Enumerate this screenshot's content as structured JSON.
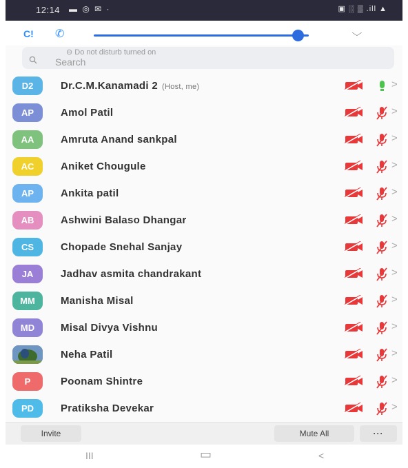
{
  "status_bar": {
    "time": "12:14",
    "left_icons": "▬ ◎ ✉ ·",
    "right_icons": "▣ ░ ▒ .ill ▲"
  },
  "notification": {
    "app_label": "C!",
    "dnd_text": "Do not disturb turned on"
  },
  "search": {
    "placeholder": "Search"
  },
  "participants": [
    {
      "initials": "D2",
      "name": "Dr.C.M.Kanamadi 2",
      "tag": "(Host, me)",
      "color": "#5ab4e6",
      "muted": false
    },
    {
      "initials": "AP",
      "name": "Amol Patil",
      "tag": "",
      "color": "#7b8ed6",
      "muted": true
    },
    {
      "initials": "AA",
      "name": "Amruta Anand sankpal",
      "tag": "",
      "color": "#7ec27e",
      "muted": true
    },
    {
      "initials": "AC",
      "name": "Aniket Chougule",
      "tag": "",
      "color": "#f0d02a",
      "muted": true
    },
    {
      "initials": "AP",
      "name": "Ankita patil",
      "tag": "",
      "color": "#6db3ef",
      "muted": true
    },
    {
      "initials": "AB",
      "name": "Ashwini Balaso Dhangar",
      "tag": "",
      "color": "#e48fbf",
      "muted": true
    },
    {
      "initials": "CS",
      "name": "Chopade Snehal Sanjay",
      "tag": "",
      "color": "#4fb6e3",
      "muted": true
    },
    {
      "initials": "JA",
      "name": "Jadhav asmita chandrakant",
      "tag": "",
      "color": "#9b7fd6",
      "muted": true
    },
    {
      "initials": "MM",
      "name": "Manisha Misal",
      "tag": "",
      "color": "#4db59e",
      "muted": true
    },
    {
      "initials": "MD",
      "name": "Misal Divya Vishnu",
      "tag": "",
      "color": "#8f84d6",
      "muted": true
    },
    {
      "initials": "",
      "name": "Neha Patil",
      "tag": "",
      "color": "#4a6f9c",
      "muted": true,
      "photo": true
    },
    {
      "initials": "P",
      "name": "Poonam  Shintre",
      "tag": "",
      "color": "#ef6a6a",
      "muted": true
    },
    {
      "initials": "PD",
      "name": "Pratiksha Devekar",
      "tag": "",
      "color": "#4fbbe8",
      "muted": true
    }
  ],
  "bottom_bar": {
    "invite_label": "Invite",
    "mute_all_label": "Mute All",
    "more_label": "···"
  },
  "nav_bar": {
    "recents": "III",
    "home": "▭",
    "back": "<"
  },
  "colors": {
    "accent": "#2d6cdf",
    "video_off": "#e8383a",
    "mic_on": "#4cc34c",
    "mic_off": "#e8383a"
  }
}
